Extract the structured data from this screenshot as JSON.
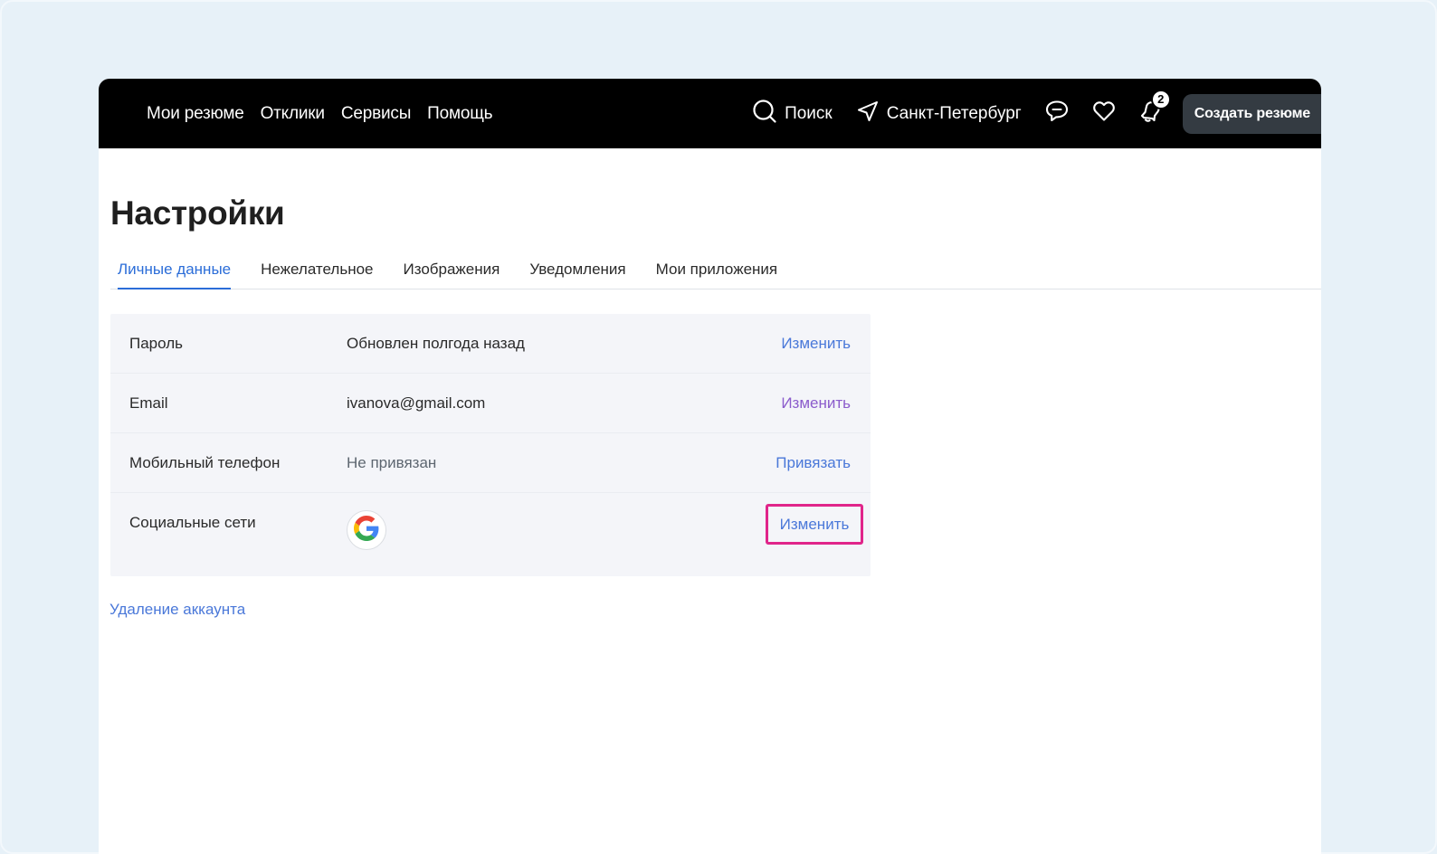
{
  "nav": {
    "left_items": [
      "Мои резюме",
      "Отклики",
      "Сервисы",
      "Помощь"
    ],
    "search_label": "Поиск",
    "city_label": "Санкт-Петербург",
    "notifications_count": "2",
    "create_resume_label": "Создать резюме"
  },
  "page": {
    "title": "Настройки"
  },
  "tabs": [
    {
      "label": "Личные данные",
      "active": true
    },
    {
      "label": "Нежелательное",
      "active": false
    },
    {
      "label": "Изображения",
      "active": false
    },
    {
      "label": "Уведомления",
      "active": false
    },
    {
      "label": "Мои приложения",
      "active": false
    }
  ],
  "settings": {
    "password": {
      "label": "Пароль",
      "value": "Обновлен полгода назад",
      "action": "Изменить"
    },
    "email": {
      "label": "Email",
      "value": "ivanova@gmail.com",
      "action": "Изменить"
    },
    "phone": {
      "label": "Мобильный телефон",
      "value": "Не привязан",
      "action": "Привязать"
    },
    "social": {
      "label": "Социальные сети",
      "provider_icon": "google-icon",
      "action": "Изменить"
    }
  },
  "delete_account_label": "Удаление аккаунта",
  "colors": {
    "accent": "#2b6dd8",
    "link": "#4a78d9",
    "highlight": "#e0258a",
    "topbar": "#000000"
  }
}
